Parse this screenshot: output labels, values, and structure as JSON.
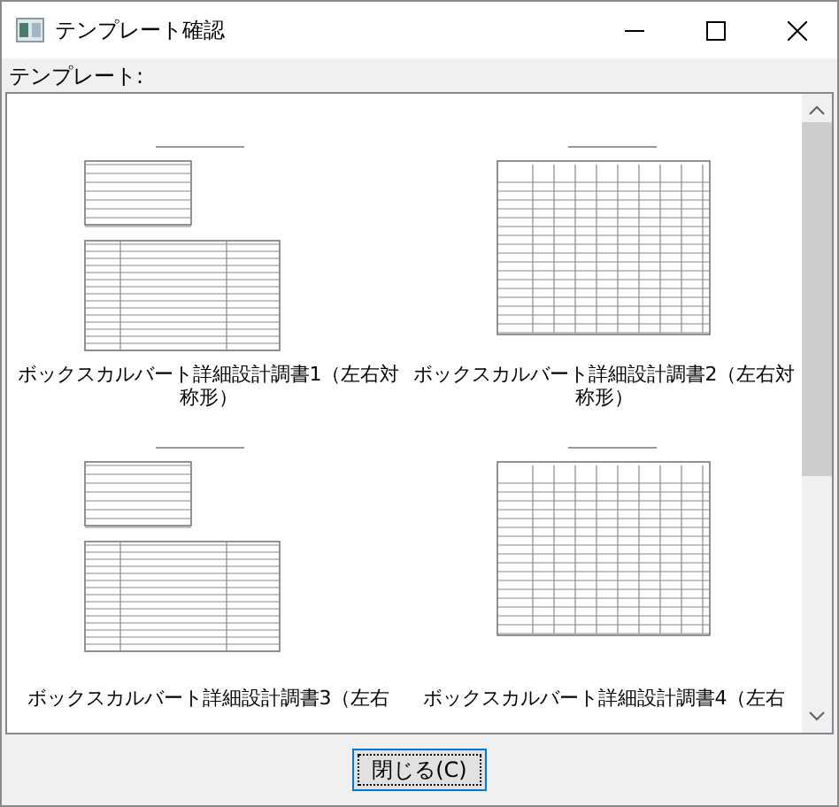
{
  "window": {
    "title": "テンプレート確認"
  },
  "list_label": "テンプレート:",
  "templates": [
    {
      "label": "ボックスカルバート詳細設計調書1（左右対称形）",
      "kind": "form"
    },
    {
      "label": "ボックスカルバート詳細設計調書2（左右対称形）",
      "kind": "grid"
    },
    {
      "label": "ボックスカルバート詳細設計調書3（左右",
      "kind": "form"
    },
    {
      "label": "ボックスカルバート詳細設計調書4（左右",
      "kind": "grid"
    }
  ],
  "buttons": [
    "閉じる(C)"
  ]
}
